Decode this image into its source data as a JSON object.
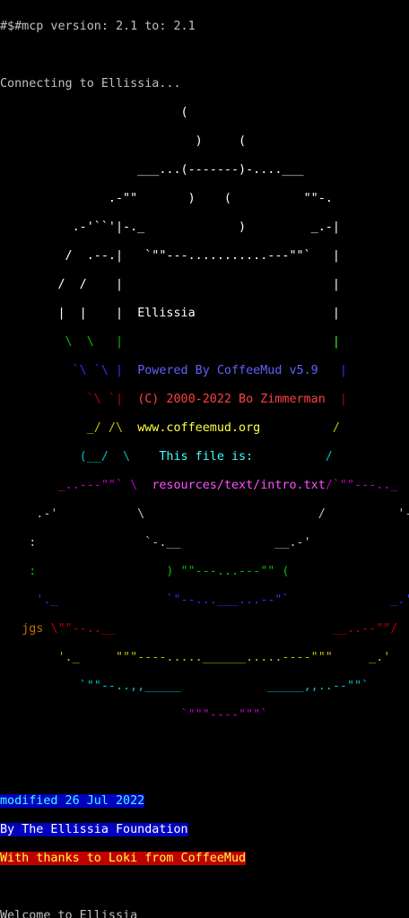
{
  "header": {
    "mcp_line": "#$#mcp version: 2.1 to: 2.1",
    "connecting": "Connecting to Ellissia..."
  },
  "banner": {
    "name": "Ellissia",
    "powered": "Powered By CoffeeMud v5.9",
    "copyright": "(C) 2000-2022 Bo Zimmerman",
    "website": "www.coffeemud.org",
    "file_label": "This file is:",
    "file_path": "resources/text/intro.txt",
    "artist": "jgs"
  },
  "footer": {
    "modified": "modified 26 Jul 2022",
    "foundation": "By The Ellissia Foundation",
    "thanks": "With thanks to Loki from CoffeeMud",
    "welcome": "Welcome to Ellissia"
  },
  "colors": {
    "background": "#000000",
    "text": "#c0c0c0",
    "highlight_blue": "#0000c0",
    "highlight_red": "#c00000"
  }
}
